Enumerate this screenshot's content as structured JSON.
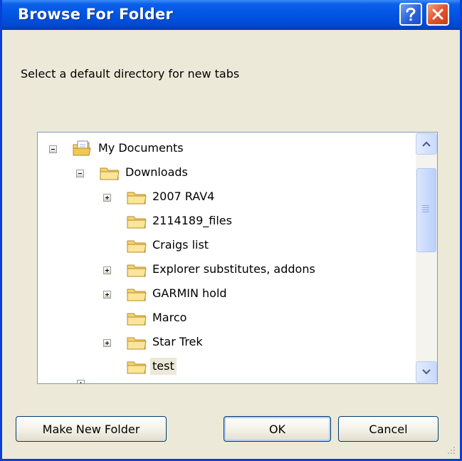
{
  "window": {
    "title": "Browse For Folder"
  },
  "dialog": {
    "prompt": "Select a default directory for new tabs"
  },
  "tree": {
    "items": [
      {
        "label": "My Documents",
        "expander": "minus",
        "icon": "my-documents-icon"
      },
      {
        "label": "Downloads",
        "expander": "minus",
        "icon": "folder-icon"
      },
      {
        "label": "2007 RAV4",
        "expander": "plus",
        "icon": "folder-icon"
      },
      {
        "label": "2114189_files",
        "expander": "none",
        "icon": "folder-icon"
      },
      {
        "label": "Craigs list",
        "expander": "none",
        "icon": "folder-icon"
      },
      {
        "label": "Explorer substitutes, addons",
        "expander": "plus",
        "icon": "folder-icon"
      },
      {
        "label": "GARMIN hold",
        "expander": "plus",
        "icon": "folder-icon"
      },
      {
        "label": "Marco",
        "expander": "none",
        "icon": "folder-icon"
      },
      {
        "label": "Star Trek",
        "expander": "plus",
        "icon": "folder-icon"
      },
      {
        "label": "test",
        "expander": "none",
        "icon": "folder-icon",
        "selected": true
      }
    ]
  },
  "buttons": {
    "make_new_folder": "Make New Folder",
    "ok": "OK",
    "cancel": "Cancel"
  },
  "colors": {
    "titlebar": "#0054e3",
    "dialog_bg": "#ece9d8",
    "close": "#e0552f",
    "border": "#7f9db9"
  }
}
